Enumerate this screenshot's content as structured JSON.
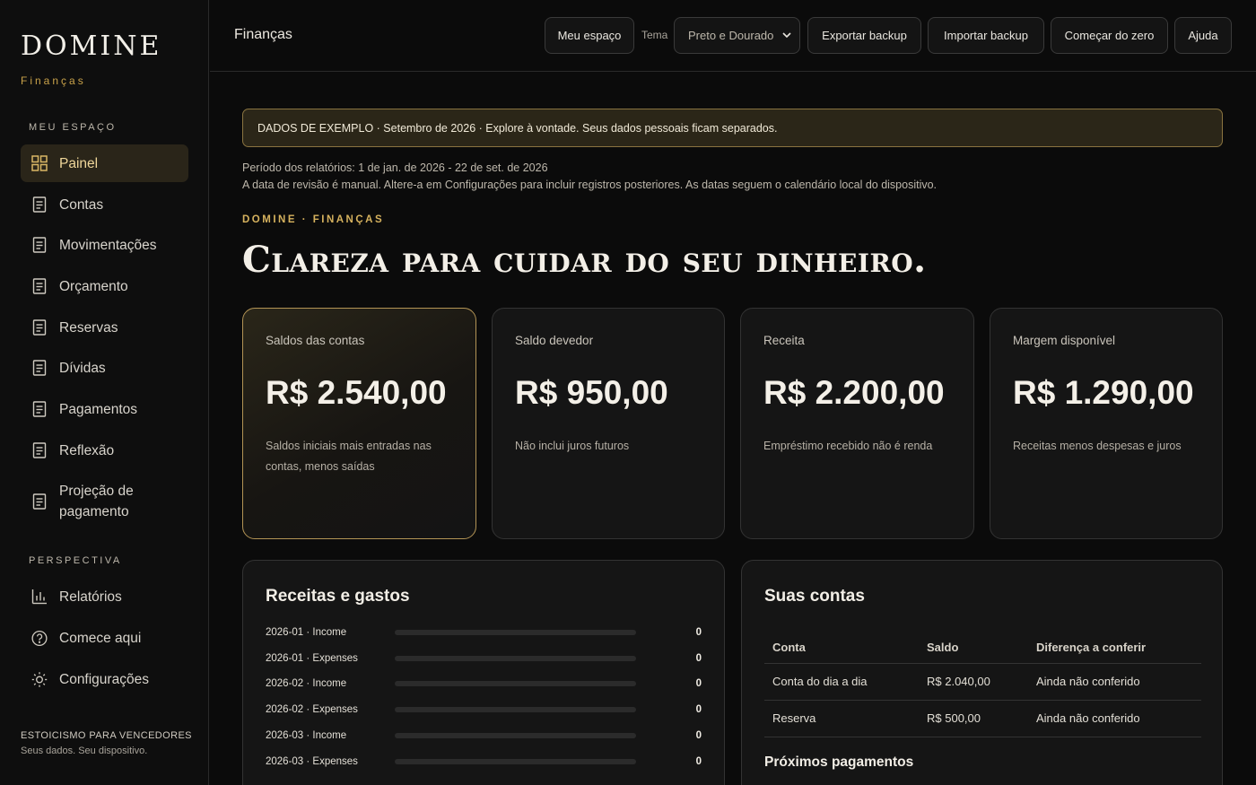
{
  "brand": {
    "name": "DOMINE",
    "subtitle": "Finanças"
  },
  "sidebar": {
    "section_main": "MEU ESPAÇO",
    "items": [
      {
        "label": "Painel",
        "icon": "grid-icon",
        "active": true
      },
      {
        "label": "Contas",
        "icon": "document-icon"
      },
      {
        "label": "Movimentações",
        "icon": "document-icon"
      },
      {
        "label": "Orçamento",
        "icon": "document-icon"
      },
      {
        "label": "Reservas",
        "icon": "document-icon"
      },
      {
        "label": "Dívidas",
        "icon": "document-icon"
      },
      {
        "label": "Pagamentos",
        "icon": "document-icon"
      },
      {
        "label": "Reflexão",
        "icon": "document-icon"
      },
      {
        "label": "Projeção de pagamento",
        "icon": "document-icon"
      }
    ],
    "section_perspective": "PERSPECTIVA",
    "items2": [
      {
        "label": "Relatórios",
        "icon": "bar-chart-icon"
      },
      {
        "label": "Comece aqui",
        "icon": "help-circle-icon"
      },
      {
        "label": "Configurações",
        "icon": "sun-gear-icon"
      }
    ],
    "footer_line1": "ESTOICISMO PARA VENCEDORES",
    "footer_line2": "Seus dados. Seu dispositivo."
  },
  "header": {
    "title": "Finanças",
    "my_space": "Meu espaço",
    "theme_label": "Tema",
    "theme_value": "Preto e Dourado",
    "export": "Exportar backup",
    "import": "Importar backup",
    "reset": "Começar do zero",
    "help": "Ajuda"
  },
  "banner": "DADOS DE EXEMPLO · Setembro de 2026 · Explore à vontade. Seus dados pessoais ficam separados.",
  "period": {
    "line1": "Período dos relatórios: 1 de jan. de 2026 - 22 de set. de 2026",
    "line2": "A data de revisão é manual. Altere-a em Configurações para incluir registros posteriores. As datas seguem o calendário local do dispositivo."
  },
  "eyebrow": "DOMINE · FINANÇAS",
  "hero": "Clareza para cuidar do seu dinheiro.",
  "cards": [
    {
      "label": "Saldos das contas",
      "value": "R$ 2.540,00",
      "note": "Saldos iniciais mais entradas nas contas, menos saídas"
    },
    {
      "label": "Saldo devedor",
      "value": "R$ 950,00",
      "note": "Não inclui juros futuros"
    },
    {
      "label": "Receita",
      "value": "R$ 2.200,00",
      "note": "Empréstimo recebido não é renda"
    },
    {
      "label": "Margem disponível",
      "value": "R$ 1.290,00",
      "note": "Receitas menos despesas e juros"
    }
  ],
  "income_expenses": {
    "title": "Receitas e gastos",
    "rows": [
      {
        "label": "2026-01 · Income",
        "value": "0",
        "fill": 0
      },
      {
        "label": "2026-01 · Expenses",
        "value": "0",
        "fill": 0
      },
      {
        "label": "2026-02 · Income",
        "value": "0",
        "fill": 0
      },
      {
        "label": "2026-02 · Expenses",
        "value": "0",
        "fill": 0
      },
      {
        "label": "2026-03 · Income",
        "value": "0",
        "fill": 0
      },
      {
        "label": "2026-03 · Expenses",
        "value": "0",
        "fill": 0
      }
    ]
  },
  "accounts": {
    "title": "Suas contas",
    "headers": [
      "Conta",
      "Saldo",
      "Diferença a conferir"
    ],
    "rows": [
      [
        "Conta do dia a dia",
        "R$ 2.040,00",
        "Ainda não conferido"
      ],
      [
        "Reserva",
        "R$ 500,00",
        "Ainda não conferido"
      ]
    ],
    "next_payments": "Próximos pagamentos"
  },
  "colors": {
    "accent": "#c9a24a",
    "background": "#0b0b0b",
    "card": "#151515"
  }
}
